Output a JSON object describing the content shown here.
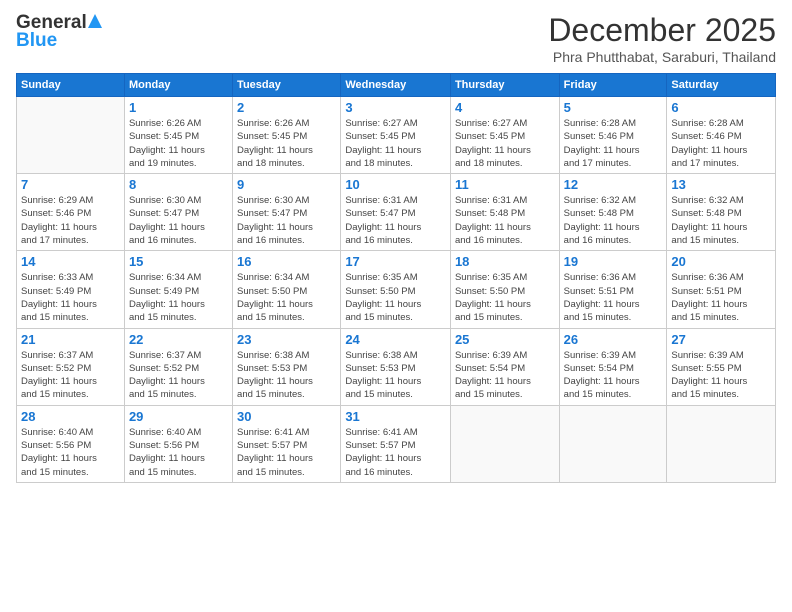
{
  "logo": {
    "line1": "General",
    "line2": "Blue"
  },
  "title": "December 2025",
  "subtitle": "Phra Phutthabat, Saraburi, Thailand",
  "days_of_week": [
    "Sunday",
    "Monday",
    "Tuesday",
    "Wednesday",
    "Thursday",
    "Friday",
    "Saturday"
  ],
  "weeks": [
    [
      {
        "day": "",
        "info": ""
      },
      {
        "day": "1",
        "info": "Sunrise: 6:26 AM\nSunset: 5:45 PM\nDaylight: 11 hours\nand 19 minutes."
      },
      {
        "day": "2",
        "info": "Sunrise: 6:26 AM\nSunset: 5:45 PM\nDaylight: 11 hours\nand 18 minutes."
      },
      {
        "day": "3",
        "info": "Sunrise: 6:27 AM\nSunset: 5:45 PM\nDaylight: 11 hours\nand 18 minutes."
      },
      {
        "day": "4",
        "info": "Sunrise: 6:27 AM\nSunset: 5:45 PM\nDaylight: 11 hours\nand 18 minutes."
      },
      {
        "day": "5",
        "info": "Sunrise: 6:28 AM\nSunset: 5:46 PM\nDaylight: 11 hours\nand 17 minutes."
      },
      {
        "day": "6",
        "info": "Sunrise: 6:28 AM\nSunset: 5:46 PM\nDaylight: 11 hours\nand 17 minutes."
      }
    ],
    [
      {
        "day": "7",
        "info": "Sunrise: 6:29 AM\nSunset: 5:46 PM\nDaylight: 11 hours\nand 17 minutes."
      },
      {
        "day": "8",
        "info": "Sunrise: 6:30 AM\nSunset: 5:47 PM\nDaylight: 11 hours\nand 16 minutes."
      },
      {
        "day": "9",
        "info": "Sunrise: 6:30 AM\nSunset: 5:47 PM\nDaylight: 11 hours\nand 16 minutes."
      },
      {
        "day": "10",
        "info": "Sunrise: 6:31 AM\nSunset: 5:47 PM\nDaylight: 11 hours\nand 16 minutes."
      },
      {
        "day": "11",
        "info": "Sunrise: 6:31 AM\nSunset: 5:48 PM\nDaylight: 11 hours\nand 16 minutes."
      },
      {
        "day": "12",
        "info": "Sunrise: 6:32 AM\nSunset: 5:48 PM\nDaylight: 11 hours\nand 16 minutes."
      },
      {
        "day": "13",
        "info": "Sunrise: 6:32 AM\nSunset: 5:48 PM\nDaylight: 11 hours\nand 15 minutes."
      }
    ],
    [
      {
        "day": "14",
        "info": "Sunrise: 6:33 AM\nSunset: 5:49 PM\nDaylight: 11 hours\nand 15 minutes."
      },
      {
        "day": "15",
        "info": "Sunrise: 6:34 AM\nSunset: 5:49 PM\nDaylight: 11 hours\nand 15 minutes."
      },
      {
        "day": "16",
        "info": "Sunrise: 6:34 AM\nSunset: 5:50 PM\nDaylight: 11 hours\nand 15 minutes."
      },
      {
        "day": "17",
        "info": "Sunrise: 6:35 AM\nSunset: 5:50 PM\nDaylight: 11 hours\nand 15 minutes."
      },
      {
        "day": "18",
        "info": "Sunrise: 6:35 AM\nSunset: 5:50 PM\nDaylight: 11 hours\nand 15 minutes."
      },
      {
        "day": "19",
        "info": "Sunrise: 6:36 AM\nSunset: 5:51 PM\nDaylight: 11 hours\nand 15 minutes."
      },
      {
        "day": "20",
        "info": "Sunrise: 6:36 AM\nSunset: 5:51 PM\nDaylight: 11 hours\nand 15 minutes."
      }
    ],
    [
      {
        "day": "21",
        "info": "Sunrise: 6:37 AM\nSunset: 5:52 PM\nDaylight: 11 hours\nand 15 minutes."
      },
      {
        "day": "22",
        "info": "Sunrise: 6:37 AM\nSunset: 5:52 PM\nDaylight: 11 hours\nand 15 minutes."
      },
      {
        "day": "23",
        "info": "Sunrise: 6:38 AM\nSunset: 5:53 PM\nDaylight: 11 hours\nand 15 minutes."
      },
      {
        "day": "24",
        "info": "Sunrise: 6:38 AM\nSunset: 5:53 PM\nDaylight: 11 hours\nand 15 minutes."
      },
      {
        "day": "25",
        "info": "Sunrise: 6:39 AM\nSunset: 5:54 PM\nDaylight: 11 hours\nand 15 minutes."
      },
      {
        "day": "26",
        "info": "Sunrise: 6:39 AM\nSunset: 5:54 PM\nDaylight: 11 hours\nand 15 minutes."
      },
      {
        "day": "27",
        "info": "Sunrise: 6:39 AM\nSunset: 5:55 PM\nDaylight: 11 hours\nand 15 minutes."
      }
    ],
    [
      {
        "day": "28",
        "info": "Sunrise: 6:40 AM\nSunset: 5:56 PM\nDaylight: 11 hours\nand 15 minutes."
      },
      {
        "day": "29",
        "info": "Sunrise: 6:40 AM\nSunset: 5:56 PM\nDaylight: 11 hours\nand 15 minutes."
      },
      {
        "day": "30",
        "info": "Sunrise: 6:41 AM\nSunset: 5:57 PM\nDaylight: 11 hours\nand 15 minutes."
      },
      {
        "day": "31",
        "info": "Sunrise: 6:41 AM\nSunset: 5:57 PM\nDaylight: 11 hours\nand 16 minutes."
      },
      {
        "day": "",
        "info": ""
      },
      {
        "day": "",
        "info": ""
      },
      {
        "day": "",
        "info": ""
      }
    ]
  ]
}
